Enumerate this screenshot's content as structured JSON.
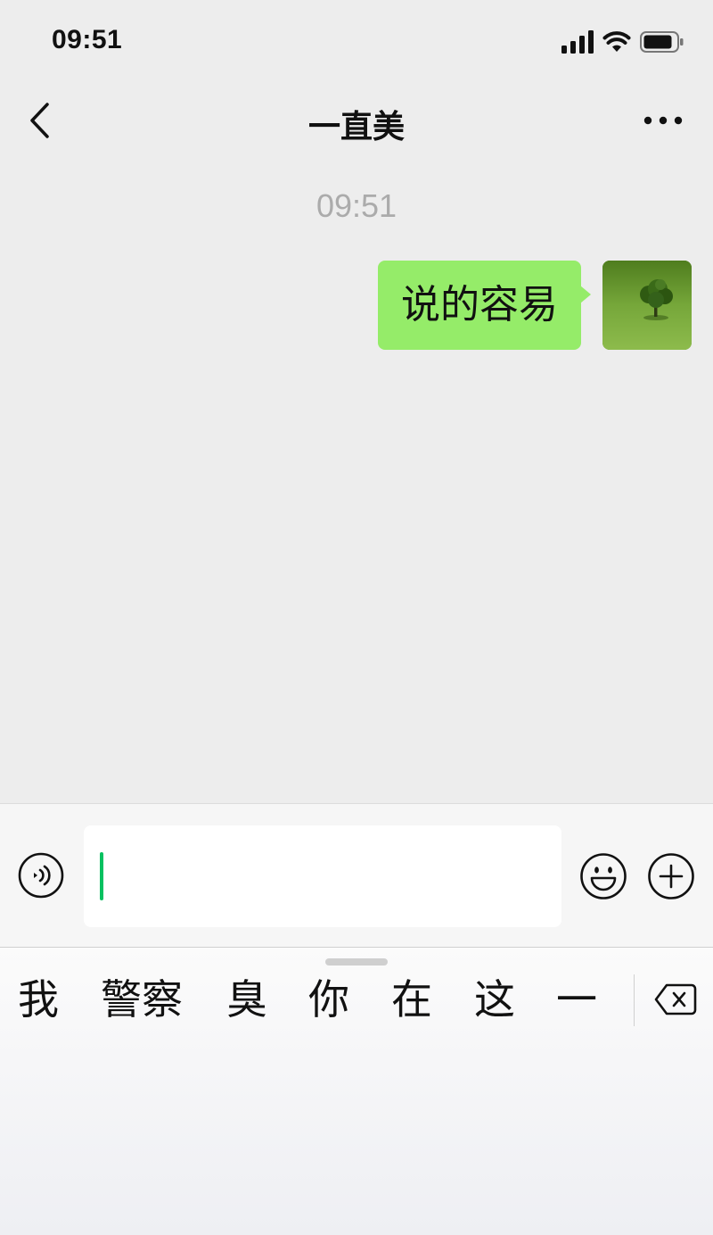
{
  "status_bar": {
    "time": "09:51",
    "icons": [
      "cellular-signal-icon",
      "wifi-icon",
      "battery-icon"
    ]
  },
  "nav": {
    "title": "一直美",
    "back_icon": "chevron-left-icon",
    "more_icon": "more-dots-icon"
  },
  "chat": {
    "timestamp": "09:51",
    "messages": [
      {
        "text": "说的容易",
        "sender": "self",
        "avatar_icon": "tree-avatar"
      }
    ]
  },
  "input_bar": {
    "voice_icon": "voice-icon",
    "input_value": "",
    "emoji_icon": "emoji-icon",
    "plus_icon": "plus-icon"
  },
  "keyboard": {
    "candidates": [
      "我",
      "警察",
      "臭",
      "你",
      "在",
      "这",
      "一"
    ],
    "delete_icon": "backspace-icon"
  },
  "colors": {
    "background": "#ededed",
    "bubble_self": "#95ec69",
    "cursor": "#07c160",
    "timestamp": "#ababab"
  }
}
